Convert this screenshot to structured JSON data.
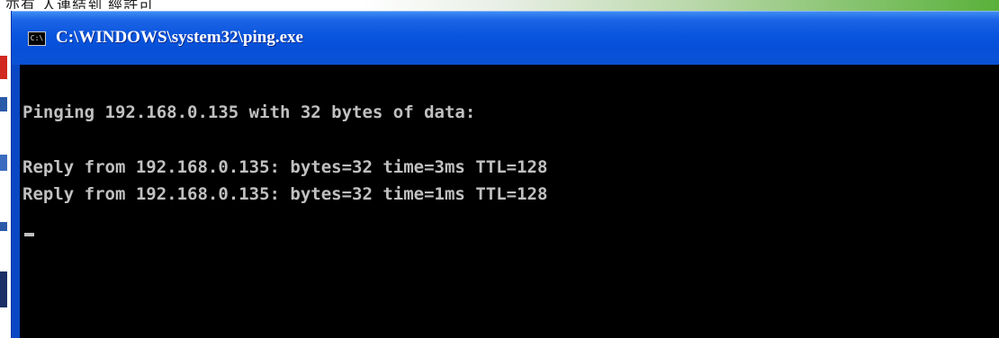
{
  "desktop": {
    "scribble": "亦有 人連結到 經許可"
  },
  "window": {
    "title": "C:\\WINDOWS\\system32\\ping.exe",
    "icon": "console-icon",
    "icon_glyph": "C:\\"
  },
  "console": {
    "lines": [
      "Pinging 192.168.0.135 with 32 bytes of data:",
      "Reply from 192.168.0.135: bytes=32 time=3ms TTL=128",
      "Reply from 192.168.0.135: bytes=32 time=1ms TTL=128"
    ],
    "text_color": "#c0c0c0",
    "background_color": "#000000"
  },
  "colors": {
    "titlebar": "#0a55de",
    "title_text": "#ffffff"
  }
}
